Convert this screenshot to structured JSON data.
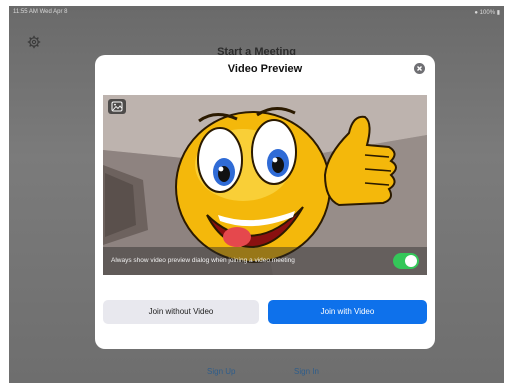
{
  "status_bar": {
    "time": "11:55 AM  Wed Apr 8",
    "battery": "● 100% ▮"
  },
  "background": {
    "heading": "Start a Meeting",
    "sign_up": "Sign Up",
    "sign_in": "Sign In"
  },
  "dialog": {
    "title": "Video Preview",
    "preview_option_label": "Always show video preview dialog when joining a video meeting",
    "preview_option_enabled": true,
    "join_without_video": "Join without Video",
    "join_with_video": "Join with Video"
  },
  "colors": {
    "primary": "#0e71eb",
    "toggle_on": "#34c759"
  }
}
